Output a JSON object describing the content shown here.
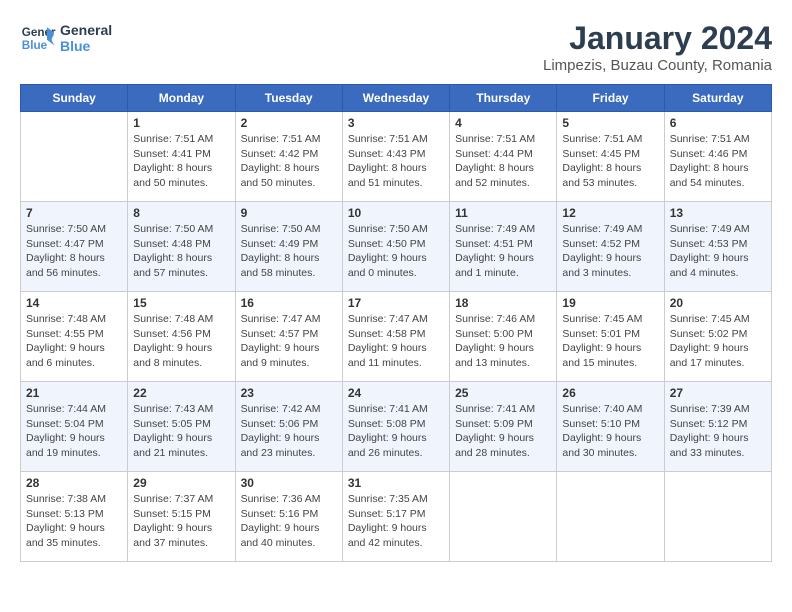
{
  "header": {
    "logo_line1": "General",
    "logo_line2": "Blue",
    "title": "January 2024",
    "subtitle": "Limpezis, Buzau County, Romania"
  },
  "calendar": {
    "days_of_week": [
      "Sunday",
      "Monday",
      "Tuesday",
      "Wednesday",
      "Thursday",
      "Friday",
      "Saturday"
    ],
    "weeks": [
      [
        {
          "day": "",
          "info": ""
        },
        {
          "day": "1",
          "info": "Sunrise: 7:51 AM\nSunset: 4:41 PM\nDaylight: 8 hours\nand 50 minutes."
        },
        {
          "day": "2",
          "info": "Sunrise: 7:51 AM\nSunset: 4:42 PM\nDaylight: 8 hours\nand 50 minutes."
        },
        {
          "day": "3",
          "info": "Sunrise: 7:51 AM\nSunset: 4:43 PM\nDaylight: 8 hours\nand 51 minutes."
        },
        {
          "day": "4",
          "info": "Sunrise: 7:51 AM\nSunset: 4:44 PM\nDaylight: 8 hours\nand 52 minutes."
        },
        {
          "day": "5",
          "info": "Sunrise: 7:51 AM\nSunset: 4:45 PM\nDaylight: 8 hours\nand 53 minutes."
        },
        {
          "day": "6",
          "info": "Sunrise: 7:51 AM\nSunset: 4:46 PM\nDaylight: 8 hours\nand 54 minutes."
        }
      ],
      [
        {
          "day": "7",
          "info": "Sunrise: 7:50 AM\nSunset: 4:47 PM\nDaylight: 8 hours\nand 56 minutes."
        },
        {
          "day": "8",
          "info": "Sunrise: 7:50 AM\nSunset: 4:48 PM\nDaylight: 8 hours\nand 57 minutes."
        },
        {
          "day": "9",
          "info": "Sunrise: 7:50 AM\nSunset: 4:49 PM\nDaylight: 8 hours\nand 58 minutes."
        },
        {
          "day": "10",
          "info": "Sunrise: 7:50 AM\nSunset: 4:50 PM\nDaylight: 9 hours\nand 0 minutes."
        },
        {
          "day": "11",
          "info": "Sunrise: 7:49 AM\nSunset: 4:51 PM\nDaylight: 9 hours\nand 1 minute."
        },
        {
          "day": "12",
          "info": "Sunrise: 7:49 AM\nSunset: 4:52 PM\nDaylight: 9 hours\nand 3 minutes."
        },
        {
          "day": "13",
          "info": "Sunrise: 7:49 AM\nSunset: 4:53 PM\nDaylight: 9 hours\nand 4 minutes."
        }
      ],
      [
        {
          "day": "14",
          "info": "Sunrise: 7:48 AM\nSunset: 4:55 PM\nDaylight: 9 hours\nand 6 minutes."
        },
        {
          "day": "15",
          "info": "Sunrise: 7:48 AM\nSunset: 4:56 PM\nDaylight: 9 hours\nand 8 minutes."
        },
        {
          "day": "16",
          "info": "Sunrise: 7:47 AM\nSunset: 4:57 PM\nDaylight: 9 hours\nand 9 minutes."
        },
        {
          "day": "17",
          "info": "Sunrise: 7:47 AM\nSunset: 4:58 PM\nDaylight: 9 hours\nand 11 minutes."
        },
        {
          "day": "18",
          "info": "Sunrise: 7:46 AM\nSunset: 5:00 PM\nDaylight: 9 hours\nand 13 minutes."
        },
        {
          "day": "19",
          "info": "Sunrise: 7:45 AM\nSunset: 5:01 PM\nDaylight: 9 hours\nand 15 minutes."
        },
        {
          "day": "20",
          "info": "Sunrise: 7:45 AM\nSunset: 5:02 PM\nDaylight: 9 hours\nand 17 minutes."
        }
      ],
      [
        {
          "day": "21",
          "info": "Sunrise: 7:44 AM\nSunset: 5:04 PM\nDaylight: 9 hours\nand 19 minutes."
        },
        {
          "day": "22",
          "info": "Sunrise: 7:43 AM\nSunset: 5:05 PM\nDaylight: 9 hours\nand 21 minutes."
        },
        {
          "day": "23",
          "info": "Sunrise: 7:42 AM\nSunset: 5:06 PM\nDaylight: 9 hours\nand 23 minutes."
        },
        {
          "day": "24",
          "info": "Sunrise: 7:41 AM\nSunset: 5:08 PM\nDaylight: 9 hours\nand 26 minutes."
        },
        {
          "day": "25",
          "info": "Sunrise: 7:41 AM\nSunset: 5:09 PM\nDaylight: 9 hours\nand 28 minutes."
        },
        {
          "day": "26",
          "info": "Sunrise: 7:40 AM\nSunset: 5:10 PM\nDaylight: 9 hours\nand 30 minutes."
        },
        {
          "day": "27",
          "info": "Sunrise: 7:39 AM\nSunset: 5:12 PM\nDaylight: 9 hours\nand 33 minutes."
        }
      ],
      [
        {
          "day": "28",
          "info": "Sunrise: 7:38 AM\nSunset: 5:13 PM\nDaylight: 9 hours\nand 35 minutes."
        },
        {
          "day": "29",
          "info": "Sunrise: 7:37 AM\nSunset: 5:15 PM\nDaylight: 9 hours\nand 37 minutes."
        },
        {
          "day": "30",
          "info": "Sunrise: 7:36 AM\nSunset: 5:16 PM\nDaylight: 9 hours\nand 40 minutes."
        },
        {
          "day": "31",
          "info": "Sunrise: 7:35 AM\nSunset: 5:17 PM\nDaylight: 9 hours\nand 42 minutes."
        },
        {
          "day": "",
          "info": ""
        },
        {
          "day": "",
          "info": ""
        },
        {
          "day": "",
          "info": ""
        }
      ]
    ]
  }
}
